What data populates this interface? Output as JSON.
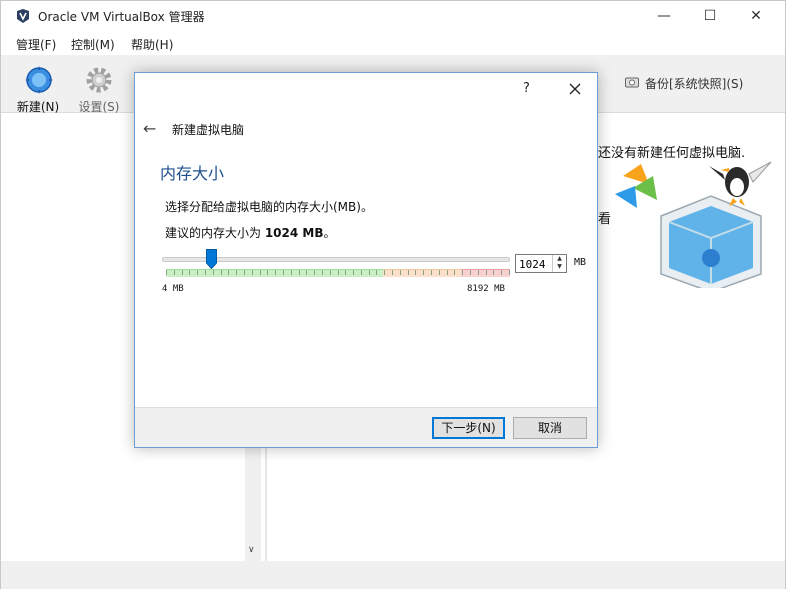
{
  "window": {
    "title": "Oracle VM VirtualBox 管理器",
    "controls": {
      "minimize": "—",
      "maximize": "☐",
      "close": "✕"
    }
  },
  "menubar": [
    {
      "label": "管理(F)"
    },
    {
      "label": "控制(M)"
    },
    {
      "label": "帮助(H)"
    }
  ],
  "toolbar": {
    "new_label": "新建(N)",
    "settings_label": "设置(S)",
    "snapshot_label": "备份[系统快照](S)"
  },
  "welcome": {
    "line1": "还没有新建任何虚拟电脑.",
    "line2": "看"
  },
  "dialog": {
    "help": "?",
    "header": "新建虚拟电脑",
    "section_title": "内存大小",
    "instruction": "选择分配给虚拟电脑的内存大小(MB)。",
    "recommend_prefix": "建议的内存大小为 ",
    "recommend_value": "1024 MB",
    "recommend_suffix": "。",
    "memory": {
      "value": "1024",
      "unit": "MB",
      "min_label": "4 MB",
      "max_label": "8192 MB",
      "min": 4,
      "max": 8192,
      "current": 1024
    },
    "next_button": "下一步(N)",
    "cancel_button": "取消"
  },
  "colors": {
    "accent": "#0078d7",
    "section_title": "#1d4f8f",
    "scale_green": "#9ee29a",
    "scale_orange": "#f6c8a4",
    "scale_red": "#f2a3a3"
  }
}
